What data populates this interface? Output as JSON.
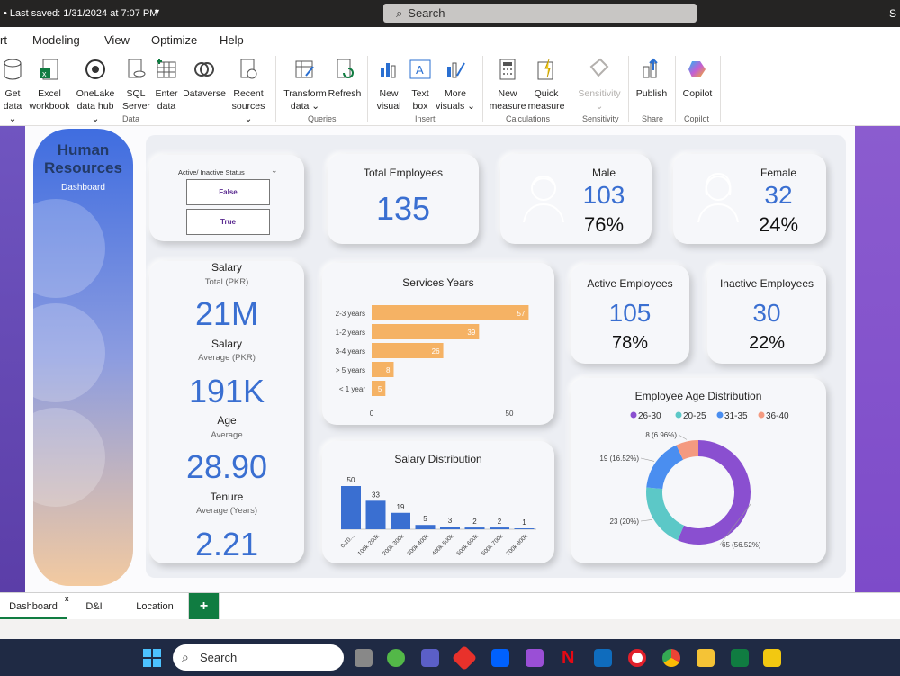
{
  "titlebar": {
    "saved": "• Last saved: 1/31/2024 at 7:07 PM",
    "search": "Search",
    "right_letter": "S"
  },
  "menu": [
    "rt",
    "Modeling",
    "View",
    "Optimize",
    "Help"
  ],
  "ribbon": {
    "buttons": [
      {
        "l1": "Get",
        "l2": "data ⌄"
      },
      {
        "l1": "Excel",
        "l2": "workbook"
      },
      {
        "l1": "OneLake",
        "l2": "data hub ⌄"
      },
      {
        "l1": "SQL",
        "l2": "Server"
      },
      {
        "l1": "Enter",
        "l2": "data"
      },
      {
        "l1": "Dataverse",
        "l2": ""
      },
      {
        "l1": "Recent",
        "l2": "sources ⌄"
      },
      {
        "l1": "Transform",
        "l2": "data ⌄"
      },
      {
        "l1": "Refresh",
        "l2": ""
      },
      {
        "l1": "New",
        "l2": "visual"
      },
      {
        "l1": "Text",
        "l2": "box"
      },
      {
        "l1": "More",
        "l2": "visuals ⌄"
      },
      {
        "l1": "New",
        "l2": "measure"
      },
      {
        "l1": "Quick",
        "l2": "measure"
      },
      {
        "l1": "Sensitivity",
        "l2": "⌄"
      },
      {
        "l1": "Publish",
        "l2": ""
      },
      {
        "l1": "Copilot",
        "l2": ""
      }
    ],
    "groups": [
      "Data",
      "Queries",
      "Insert",
      "Calculations",
      "Sensitivity",
      "Share",
      "Copilot"
    ]
  },
  "sidebar": {
    "title1": "Human",
    "title2": "Resources",
    "subtitle": "Dashboard"
  },
  "slicer": {
    "title": "Active/ Inactive Status",
    "options": [
      "False",
      "True"
    ]
  },
  "total_employees": {
    "label": "Total Employees",
    "value": "135"
  },
  "male": {
    "label": "Male",
    "value": "103",
    "pct": "76%"
  },
  "female": {
    "label": "Female",
    "value": "32",
    "pct": "24%"
  },
  "salary_card": {
    "salary_label": "Salary",
    "salary_sub": "Total (PKR)",
    "salary_value": "21M",
    "avg_label": "Salary",
    "avg_sub": "Average (PKR)",
    "avg_value": "191K",
    "age_label": "Age",
    "age_sub": "Average",
    "age_value": "28.90",
    "tenure_label": "Tenure",
    "tenure_sub": "Average (Years)",
    "tenure_value": "2.21"
  },
  "active": {
    "label": "Active Employees",
    "value": "105",
    "pct": "78%"
  },
  "inactive": {
    "label": "Inactive Employees",
    "value": "30",
    "pct": "22%"
  },
  "tabs": [
    "Dashboard",
    "D&I",
    "Location",
    "+"
  ],
  "taskbar": {
    "search": "Search"
  },
  "colors": {
    "accent": "#3a6fd1",
    "bar_orange": "#f5b264",
    "bar_blue": "#3a6fd1",
    "purple": "#8a4fd0",
    "teal": "#5cc8c7",
    "blue": "#4a8ef0",
    "salmon": "#f49a80"
  },
  "chart_data": [
    {
      "type": "bar",
      "orientation": "horizontal",
      "title": "Services Years",
      "categories": [
        "2-3 years",
        "1-2 years",
        "3-4 years",
        "> 5 years",
        "< 1 year"
      ],
      "values": [
        57,
        39,
        26,
        8,
        5
      ],
      "xticks": [
        "0",
        "50"
      ]
    },
    {
      "type": "bar",
      "title": "Salary Distribution",
      "categories": [
        "0-10...",
        "100k-200k",
        "200k-300k",
        "300k-400k",
        "400k-500k",
        "500k-600k",
        "600k-700k",
        "700k-800k"
      ],
      "values": [
        50,
        33,
        19,
        5,
        3,
        2,
        2,
        1
      ]
    },
    {
      "type": "pie",
      "title": "Employee Age Distribution",
      "labels": [
        "26-30",
        "20-25",
        "31-35",
        "36-40"
      ],
      "values": [
        65,
        23,
        19,
        8
      ],
      "data_labels": [
        "65 (56.52%)",
        "23 (20%)",
        "19 (16.52%)",
        "8 (6.96%)"
      ]
    }
  ]
}
